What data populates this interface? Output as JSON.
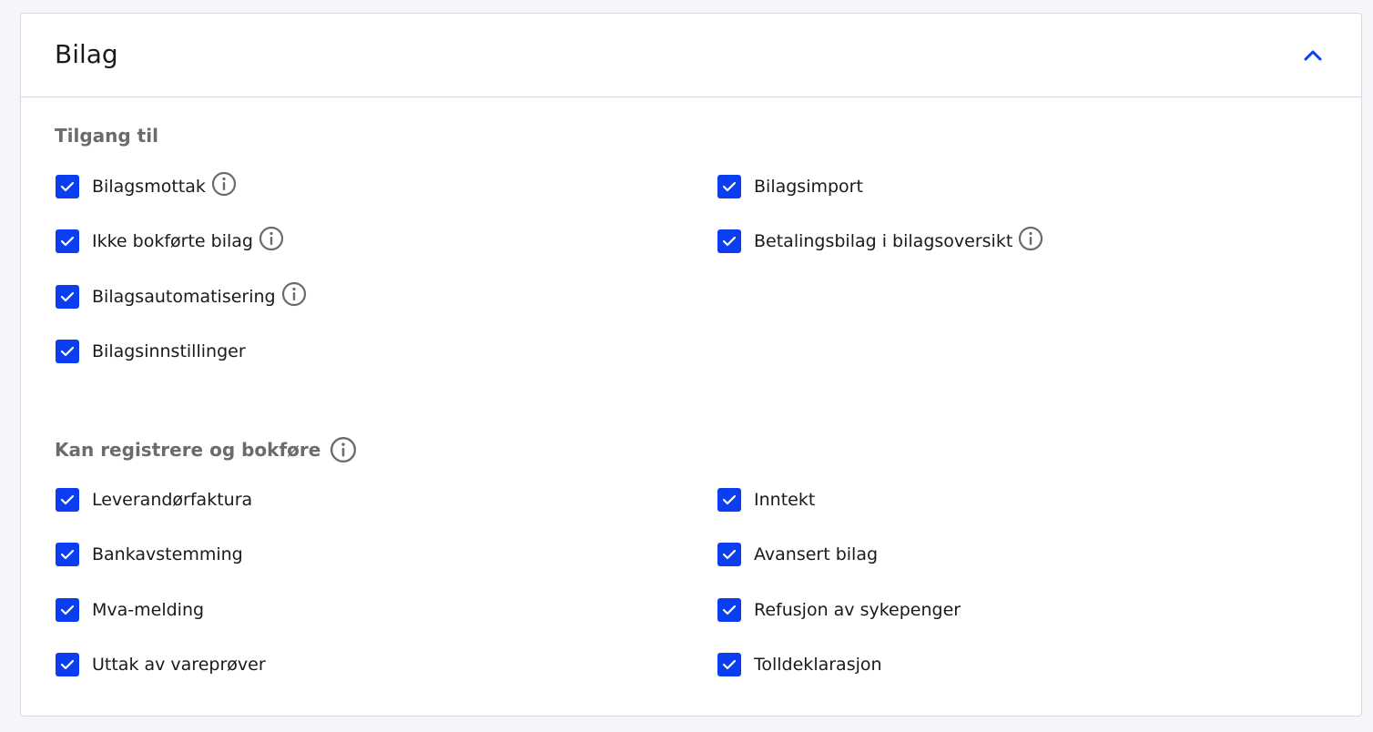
{
  "panel": {
    "title": "Bilag",
    "collapse_icon": "chevron-up-icon",
    "accent_color": "#0a3ef0"
  },
  "sections": [
    {
      "title": "Tilgang til",
      "has_info": false,
      "left": [
        {
          "label": "Bilagsmottak",
          "checked": true,
          "info": true
        },
        {
          "label": "Ikke bokførte bilag",
          "checked": true,
          "info": true
        },
        {
          "label": "Bilagsautomatisering",
          "checked": true,
          "info": true
        },
        {
          "label": "Bilagsinnstillinger",
          "checked": true,
          "info": false
        }
      ],
      "right": [
        {
          "label": "Bilagsimport",
          "checked": true,
          "info": false
        },
        {
          "label": "Betalingsbilag i bilagsoversikt",
          "checked": true,
          "info": true
        }
      ]
    },
    {
      "title": "Kan registrere og bokføre",
      "has_info": true,
      "left": [
        {
          "label": "Leverandørfaktura",
          "checked": true,
          "info": false
        },
        {
          "label": "Bankavstemming",
          "checked": true,
          "info": false
        },
        {
          "label": "Mva-melding",
          "checked": true,
          "info": false
        },
        {
          "label": "Uttak av vareprøver",
          "checked": true,
          "info": false
        }
      ],
      "right": [
        {
          "label": "Inntekt",
          "checked": true,
          "info": false
        },
        {
          "label": "Avansert bilag",
          "checked": true,
          "info": false
        },
        {
          "label": "Refusjon av sykepenger",
          "checked": true,
          "info": false
        },
        {
          "label": "Tolldeklarasjon",
          "checked": true,
          "info": false
        }
      ]
    }
  ]
}
